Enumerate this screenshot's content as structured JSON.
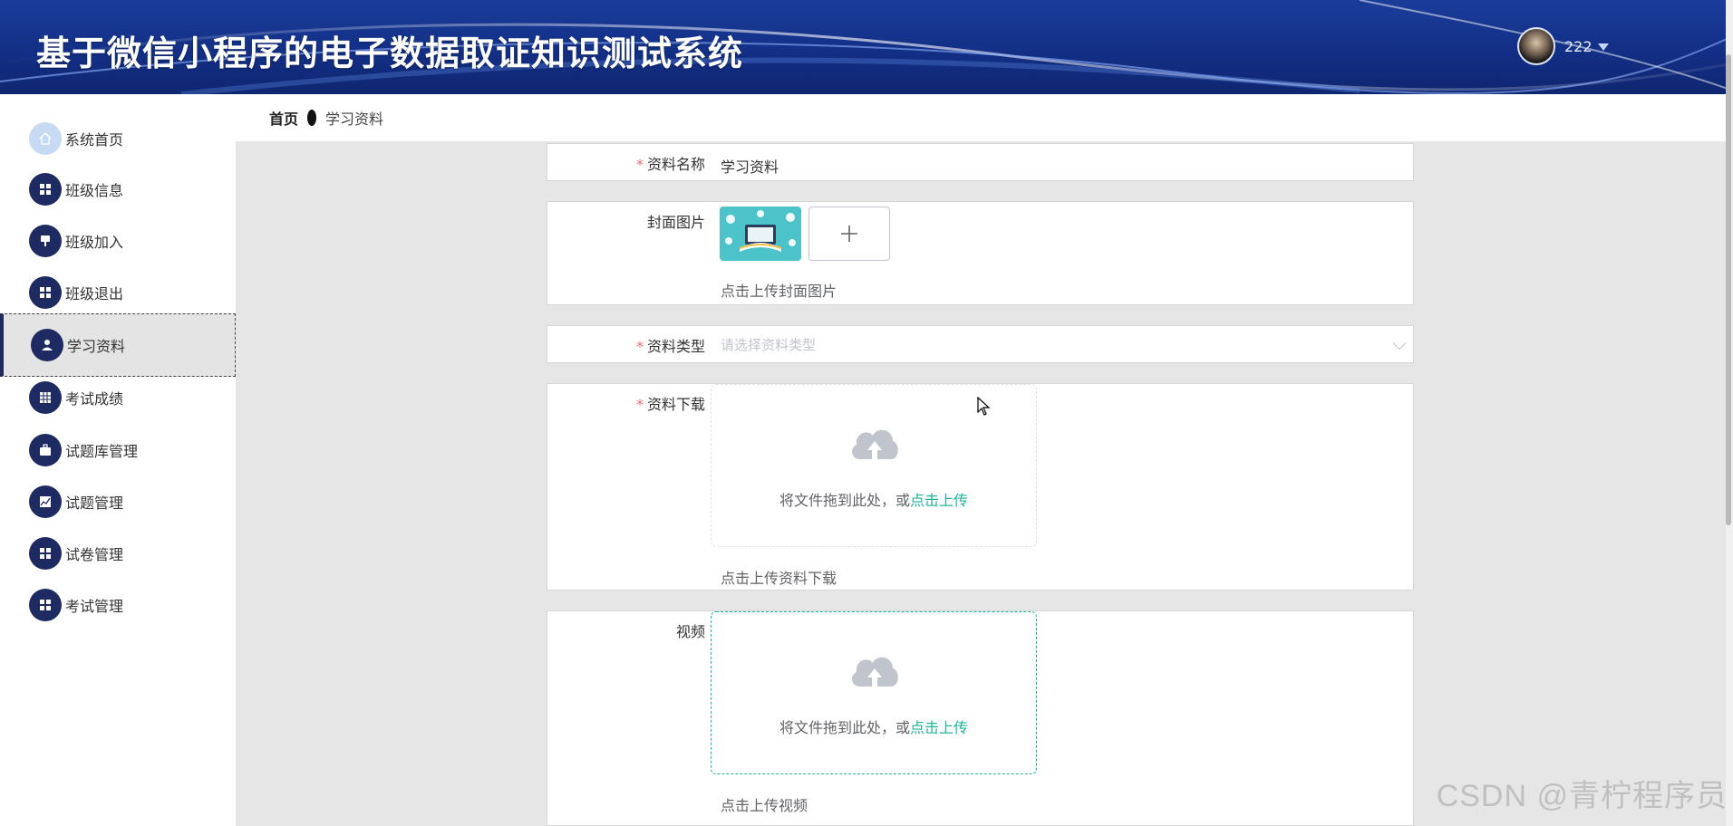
{
  "header": {
    "title": "基于微信小程序的电子数据取证知识测试系统",
    "username": "222"
  },
  "breadcrumb": {
    "home": "首页",
    "current": "学习资料"
  },
  "sidebar": {
    "items": [
      {
        "label": "系统首页",
        "icon": "home-icon",
        "active": false
      },
      {
        "label": "班级信息",
        "icon": "grid-icon",
        "active": false
      },
      {
        "label": "班级加入",
        "icon": "pin-icon",
        "active": false
      },
      {
        "label": "班级退出",
        "icon": "grid-icon",
        "active": false
      },
      {
        "label": "学习资料",
        "icon": "user-icon",
        "active": true
      },
      {
        "label": "考试成绩",
        "icon": "table-icon",
        "active": false
      },
      {
        "label": "试题库管理",
        "icon": "briefcase-icon",
        "active": false
      },
      {
        "label": "试题管理",
        "icon": "chart-icon",
        "active": false
      },
      {
        "label": "试卷管理",
        "icon": "grid-icon",
        "active": false
      },
      {
        "label": "考试管理",
        "icon": "grid-icon",
        "active": false
      }
    ]
  },
  "form": {
    "name": {
      "label": "资料名称",
      "required": true,
      "value": "学习资料"
    },
    "cover": {
      "label": "封面图片",
      "required": false,
      "hint": "点击上传封面图片"
    },
    "type": {
      "label": "资料类型",
      "required": true,
      "placeholder": "请选择资料类型"
    },
    "download": {
      "label": "资料下载",
      "required": true,
      "upload_text": "将文件拖到此处，或",
      "upload_link": "点击上传",
      "hint": "点击上传资料下载"
    },
    "video": {
      "label": "视频",
      "required": false,
      "upload_text": "将文件拖到此处，或",
      "upload_link": "点击上传",
      "hint": "点击上传视频"
    }
  },
  "watermark": "CSDN @青柠程序员",
  "colors": {
    "header_bg": "#132f86",
    "sidebar_icon": "#1e2b63",
    "accent": "#1fb59b",
    "required": "#f56c6c"
  }
}
